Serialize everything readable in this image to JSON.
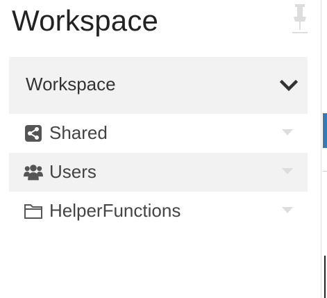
{
  "panel": {
    "title": "Workspace",
    "pin_icon": "pin-icon"
  },
  "accordion": {
    "header_label": "Workspace",
    "expanded": true,
    "chevron_icon": "chevron-down-icon"
  },
  "items": [
    {
      "label": "Shared",
      "icon": "share-icon",
      "highlighted": false
    },
    {
      "label": "Users",
      "icon": "users-icon",
      "highlighted": true
    },
    {
      "label": "HelperFunctions",
      "icon": "folder-icon",
      "highlighted": false
    }
  ],
  "colors": {
    "header_bg": "#f2f2f2",
    "accent": "#337ab7",
    "text": "#333333"
  }
}
